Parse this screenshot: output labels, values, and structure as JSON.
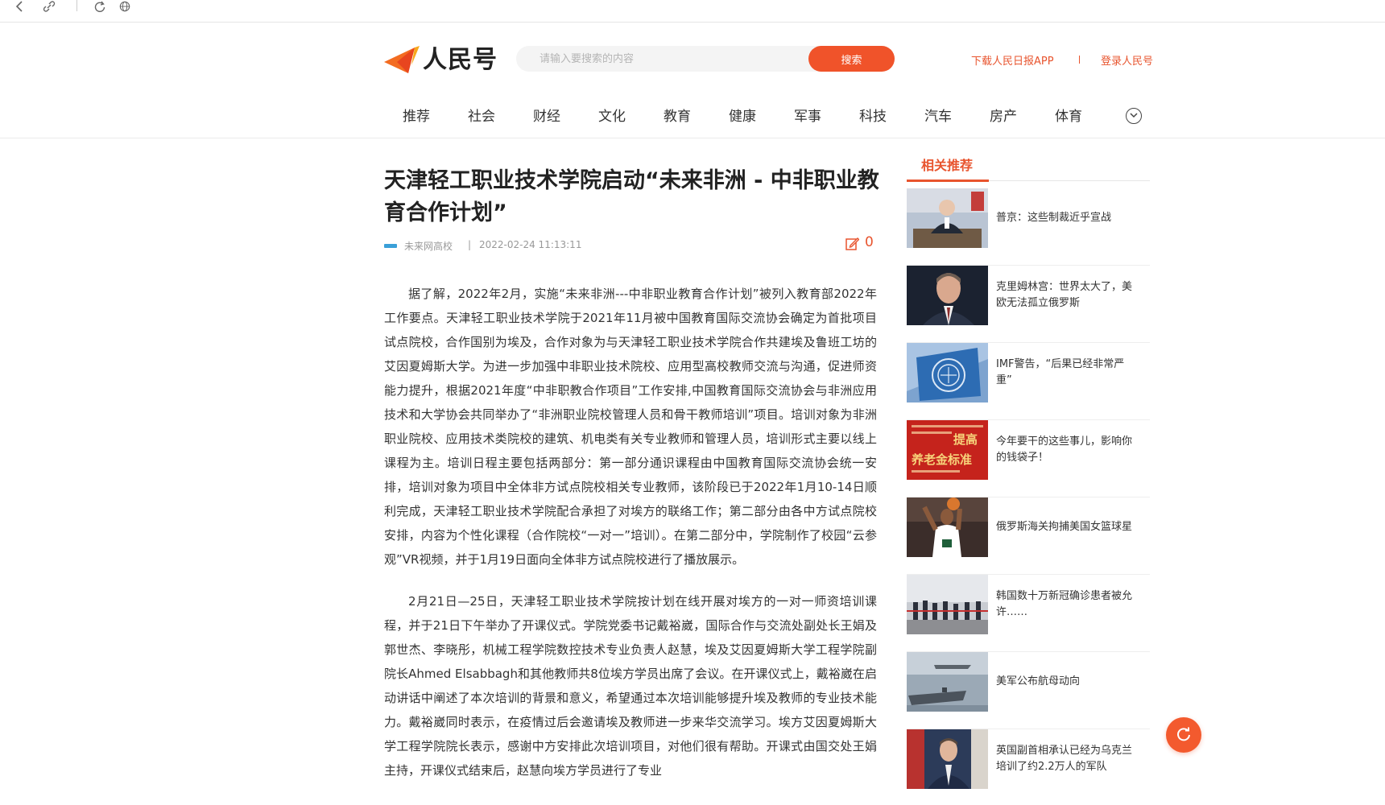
{
  "browser": {
    "back_icon": "chevron-left-icon",
    "link_icon": "link-icon",
    "refresh_icon": "refresh-icon",
    "globe_icon": "globe-icon"
  },
  "header": {
    "logo_text": "人民号",
    "search_placeholder": "请输入要搜索的内容",
    "search_label": "搜索",
    "download_link": "下载人民日报APP",
    "login_link": "登录人民号"
  },
  "nav": {
    "items": [
      "推荐",
      "社会",
      "财经",
      "文化",
      "教育",
      "健康",
      "军事",
      "科技",
      "汽车",
      "房产",
      "体育"
    ],
    "more_icon": "chevron-down-circle-icon"
  },
  "article": {
    "title": "天津轻工职业技术学院启动“未来非洲 - 中非职业教育合作计划”",
    "source": "未来网高校",
    "separator": "|",
    "time": "2022-02-24 11:13:11",
    "comment_count": "0",
    "paragraphs": [
      "据了解，2022年2月，实施“未来非洲---中非职业教育合作计划”被列入教育部2022年工作要点。天津轻工职业技术学院于2021年11月被中国教育国际交流协会确定为首批项目试点院校，合作国别为埃及，合作对象为与天津轻工职业技术学院合作共建埃及鲁班工坊的艾因夏姆斯大学。为进一步加强中非职业技术院校、应用型高校教师交流与沟通，促进师资能力提升，根据2021年度“中非职教合作项目”工作安排,中国教育国际交流协会与非洲应用技术和大学协会共同举办了“非洲职业院校管理人员和骨干教师培训”项目。培训对象为非洲职业院校、应用技术类院校的建筑、机电类有关专业教师和管理人员，培训形式主要以线上课程为主。培训日程主要包括两部分：第一部分通识课程由中国教育国际交流协会统一安排，培训对象为项目中全体非方试点院校相关专业教师，该阶段已于2022年1月10-14日顺利完成，天津轻工职业技术学院配合承担了对埃方的联络工作；第二部分由各中方试点院校安排，内容为个性化课程（合作院校“一对一”培训）。在第二部分中，学院制作了校园“云参观”VR视频，并于1月19日面向全体非方试点院校进行了播放展示。",
      "2月21日—25日，天津轻工职业技术学院按计划在线开展对埃方的一对一师资培训课程，并于21日下午举办了开课仪式。学院党委书记戴裕崴，国际合作与交流处副处长王娟及郭世杰、李晓彤，机械工程学院数控技术专业负责人赵慧，埃及艾因夏姆斯大学工程学院副院长Ahmed Elsabbagh和其他教师共8位埃方学员出席了会议。在开课仪式上，戴裕崴在启动讲话中阐述了本次培训的背景和意义，希望通过本次培训能够提升埃及教师的专业技术能力。戴裕崴同时表示，在疫情过后会邀请埃及教师进一步来华交流学习。埃方艾因夏姆斯大学工程学院院长表示，感谢中方安排此次培训项目，对他们很有帮助。开课式由国交处王娟主持，开课仪式结束后，赵慧向埃方学员进行了专业"
    ]
  },
  "sidebar": {
    "title": "相关推荐",
    "items": [
      {
        "title": "普京：这些制裁近乎宣战",
        "thumb": "person-at-desk-thumb"
      },
      {
        "title": "克里姆林宫：世界太大了，美欧无法孤立俄罗斯",
        "thumb": "man-portrait-thumb"
      },
      {
        "title": "IMF警告，“后果已经非常严重”",
        "thumb": "imf-seal-thumb"
      },
      {
        "title": "今年要干的这些事儿，影响你的钱袋子！",
        "thumb": "red-poster-thumb"
      },
      {
        "title": "俄罗斯海关拘捕美国女篮球星",
        "thumb": "basketball-player-thumb"
      },
      {
        "title": "韩国数十万新冠确诊患者被允许……",
        "thumb": "queue-crowd-thumb"
      },
      {
        "title": "美军公布航母动向",
        "thumb": "aircraft-carrier-thumb"
      },
      {
        "title": "英国副首相承认已经为乌克兰培训了约2.2万人的军队",
        "thumb": "man-speaking-thumb"
      }
    ],
    "thumb_text_poster_top": "提高",
    "thumb_text_poster_bottom": "养老金标准"
  },
  "colors": {
    "accent": "#e8542e",
    "search_button": "#f0532a",
    "refresh_button": "#f35a2e"
  },
  "float": {
    "refresh_icon": "refresh-icon"
  }
}
